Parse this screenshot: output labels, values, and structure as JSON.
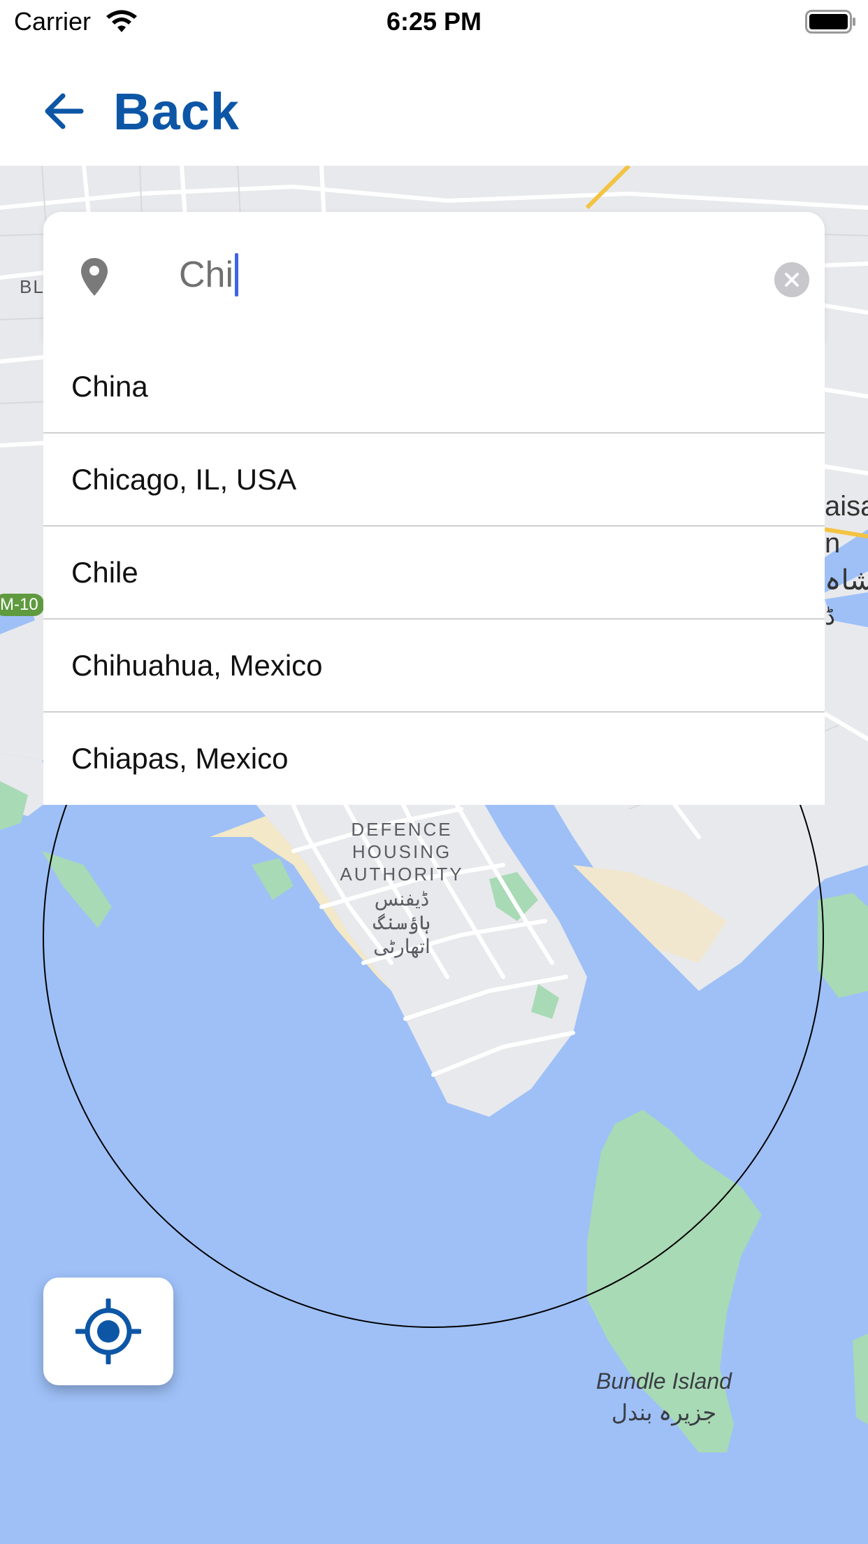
{
  "status_bar": {
    "carrier": "Carrier",
    "time": "6:25 PM",
    "wifi_icon": "wifi-icon",
    "battery_icon": "battery-icon"
  },
  "nav": {
    "back_label": "Back",
    "back_icon": "arrow-left-icon",
    "accent_color": "#0d56a6"
  },
  "search": {
    "value": "Chi",
    "pin_icon": "location-pin-icon",
    "clear_icon": "clear-circle-icon"
  },
  "suggestions": [
    {
      "label": "China"
    },
    {
      "label": "Chicago, IL, USA"
    },
    {
      "label": "Chile"
    },
    {
      "label": "Chihuahua, Mexico"
    },
    {
      "label": "Chiapas, Mexico"
    }
  ],
  "map": {
    "dha_label_en": [
      "DEFENCE",
      "HOUSING",
      "AUTHORITY"
    ],
    "dha_label_ur": [
      "ڈیفنس",
      "ہاؤسنگ",
      "اتھارٹی"
    ],
    "bundle_label_en": "Bundle Island",
    "bundle_label_ur": "جزیرہ بندل",
    "road_badge": "M-10",
    "edge_left": "BL",
    "edge_right": [
      "aisa",
      "n",
      "شاہ",
      "ڈ"
    ],
    "water_color": "#9ec0f7",
    "land_color": "#e8e9ec",
    "park_color": "#a8dab5"
  },
  "locate_button": {
    "icon": "my-location-icon"
  }
}
